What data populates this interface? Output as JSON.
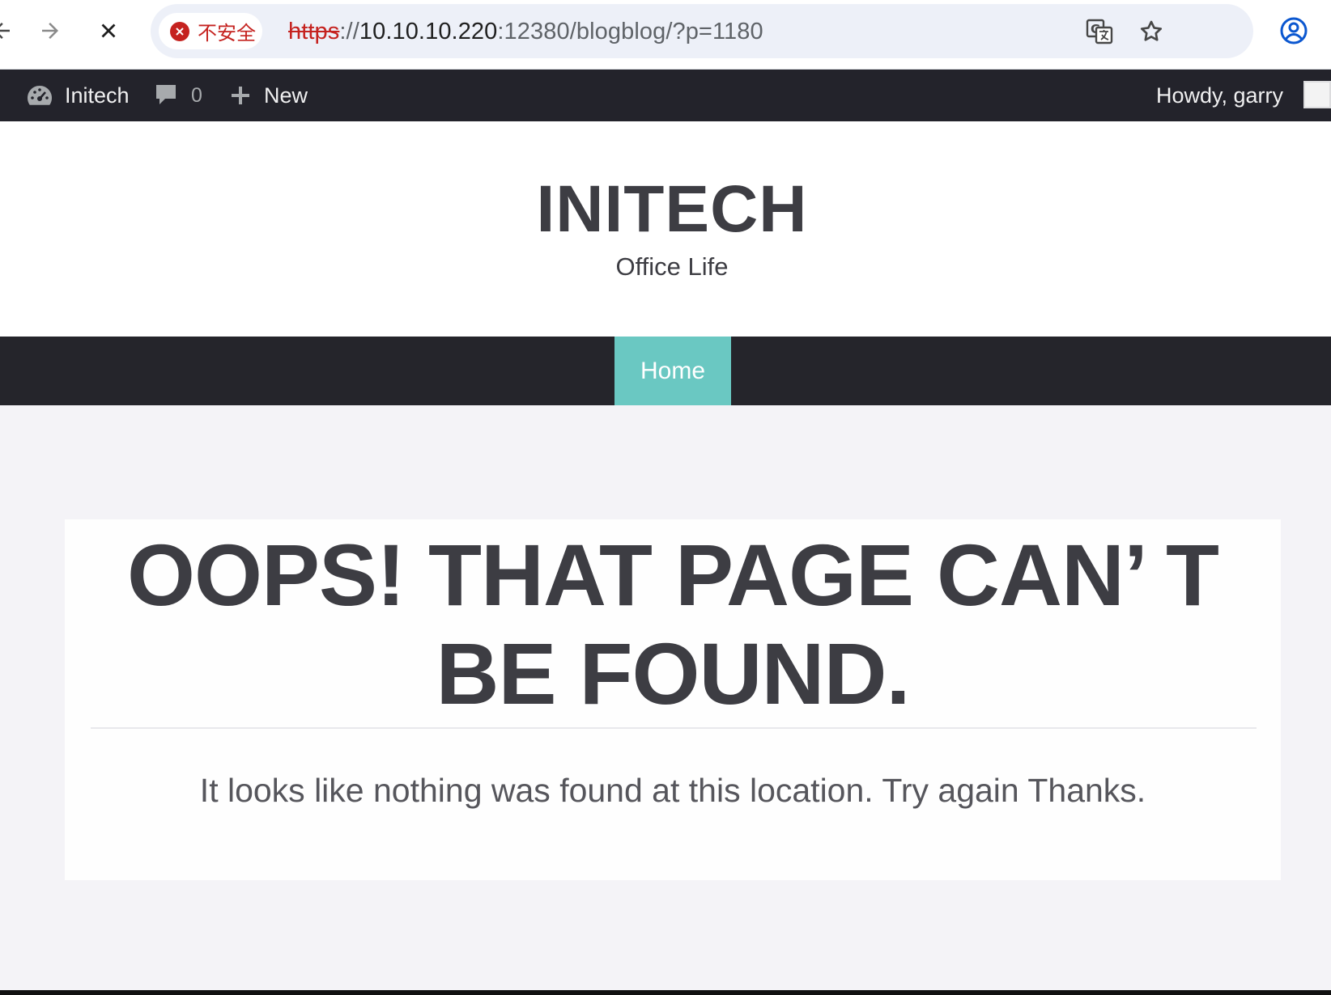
{
  "browser": {
    "security_label": "不安全",
    "url_scheme": "https",
    "url_sep": "://",
    "url_host": "10.10.10.220",
    "url_port": ":12380",
    "url_path": "/blogblog/?p=1180",
    "icons": [
      "back-icon",
      "forward-icon",
      "stop-loading-icon",
      "not-secure-icon",
      "translate-icon",
      "bookmark-star-icon",
      "profile-icon"
    ]
  },
  "admin_bar": {
    "site_name": "Initech",
    "comments_count": "0",
    "new_label": "New",
    "greeting": "Howdy, garry"
  },
  "site": {
    "title": "INITECH",
    "description": "Office Life"
  },
  "nav": {
    "items": [
      {
        "label": "Home",
        "active": true
      }
    ]
  },
  "content": {
    "error_title": "OOPS! THAT PAGE CAN’ T BE FOUND.",
    "error_message": "It looks like nothing was found at this location. Try again Thanks."
  },
  "colors": {
    "admin_bar_bg": "#23232b",
    "nav_bg": "#25252b",
    "nav_active_bg": "#6ac8c2",
    "page_bg": "#f4f3f7",
    "text_dark": "#3d3d43",
    "not_secure_red": "#c5221f"
  }
}
